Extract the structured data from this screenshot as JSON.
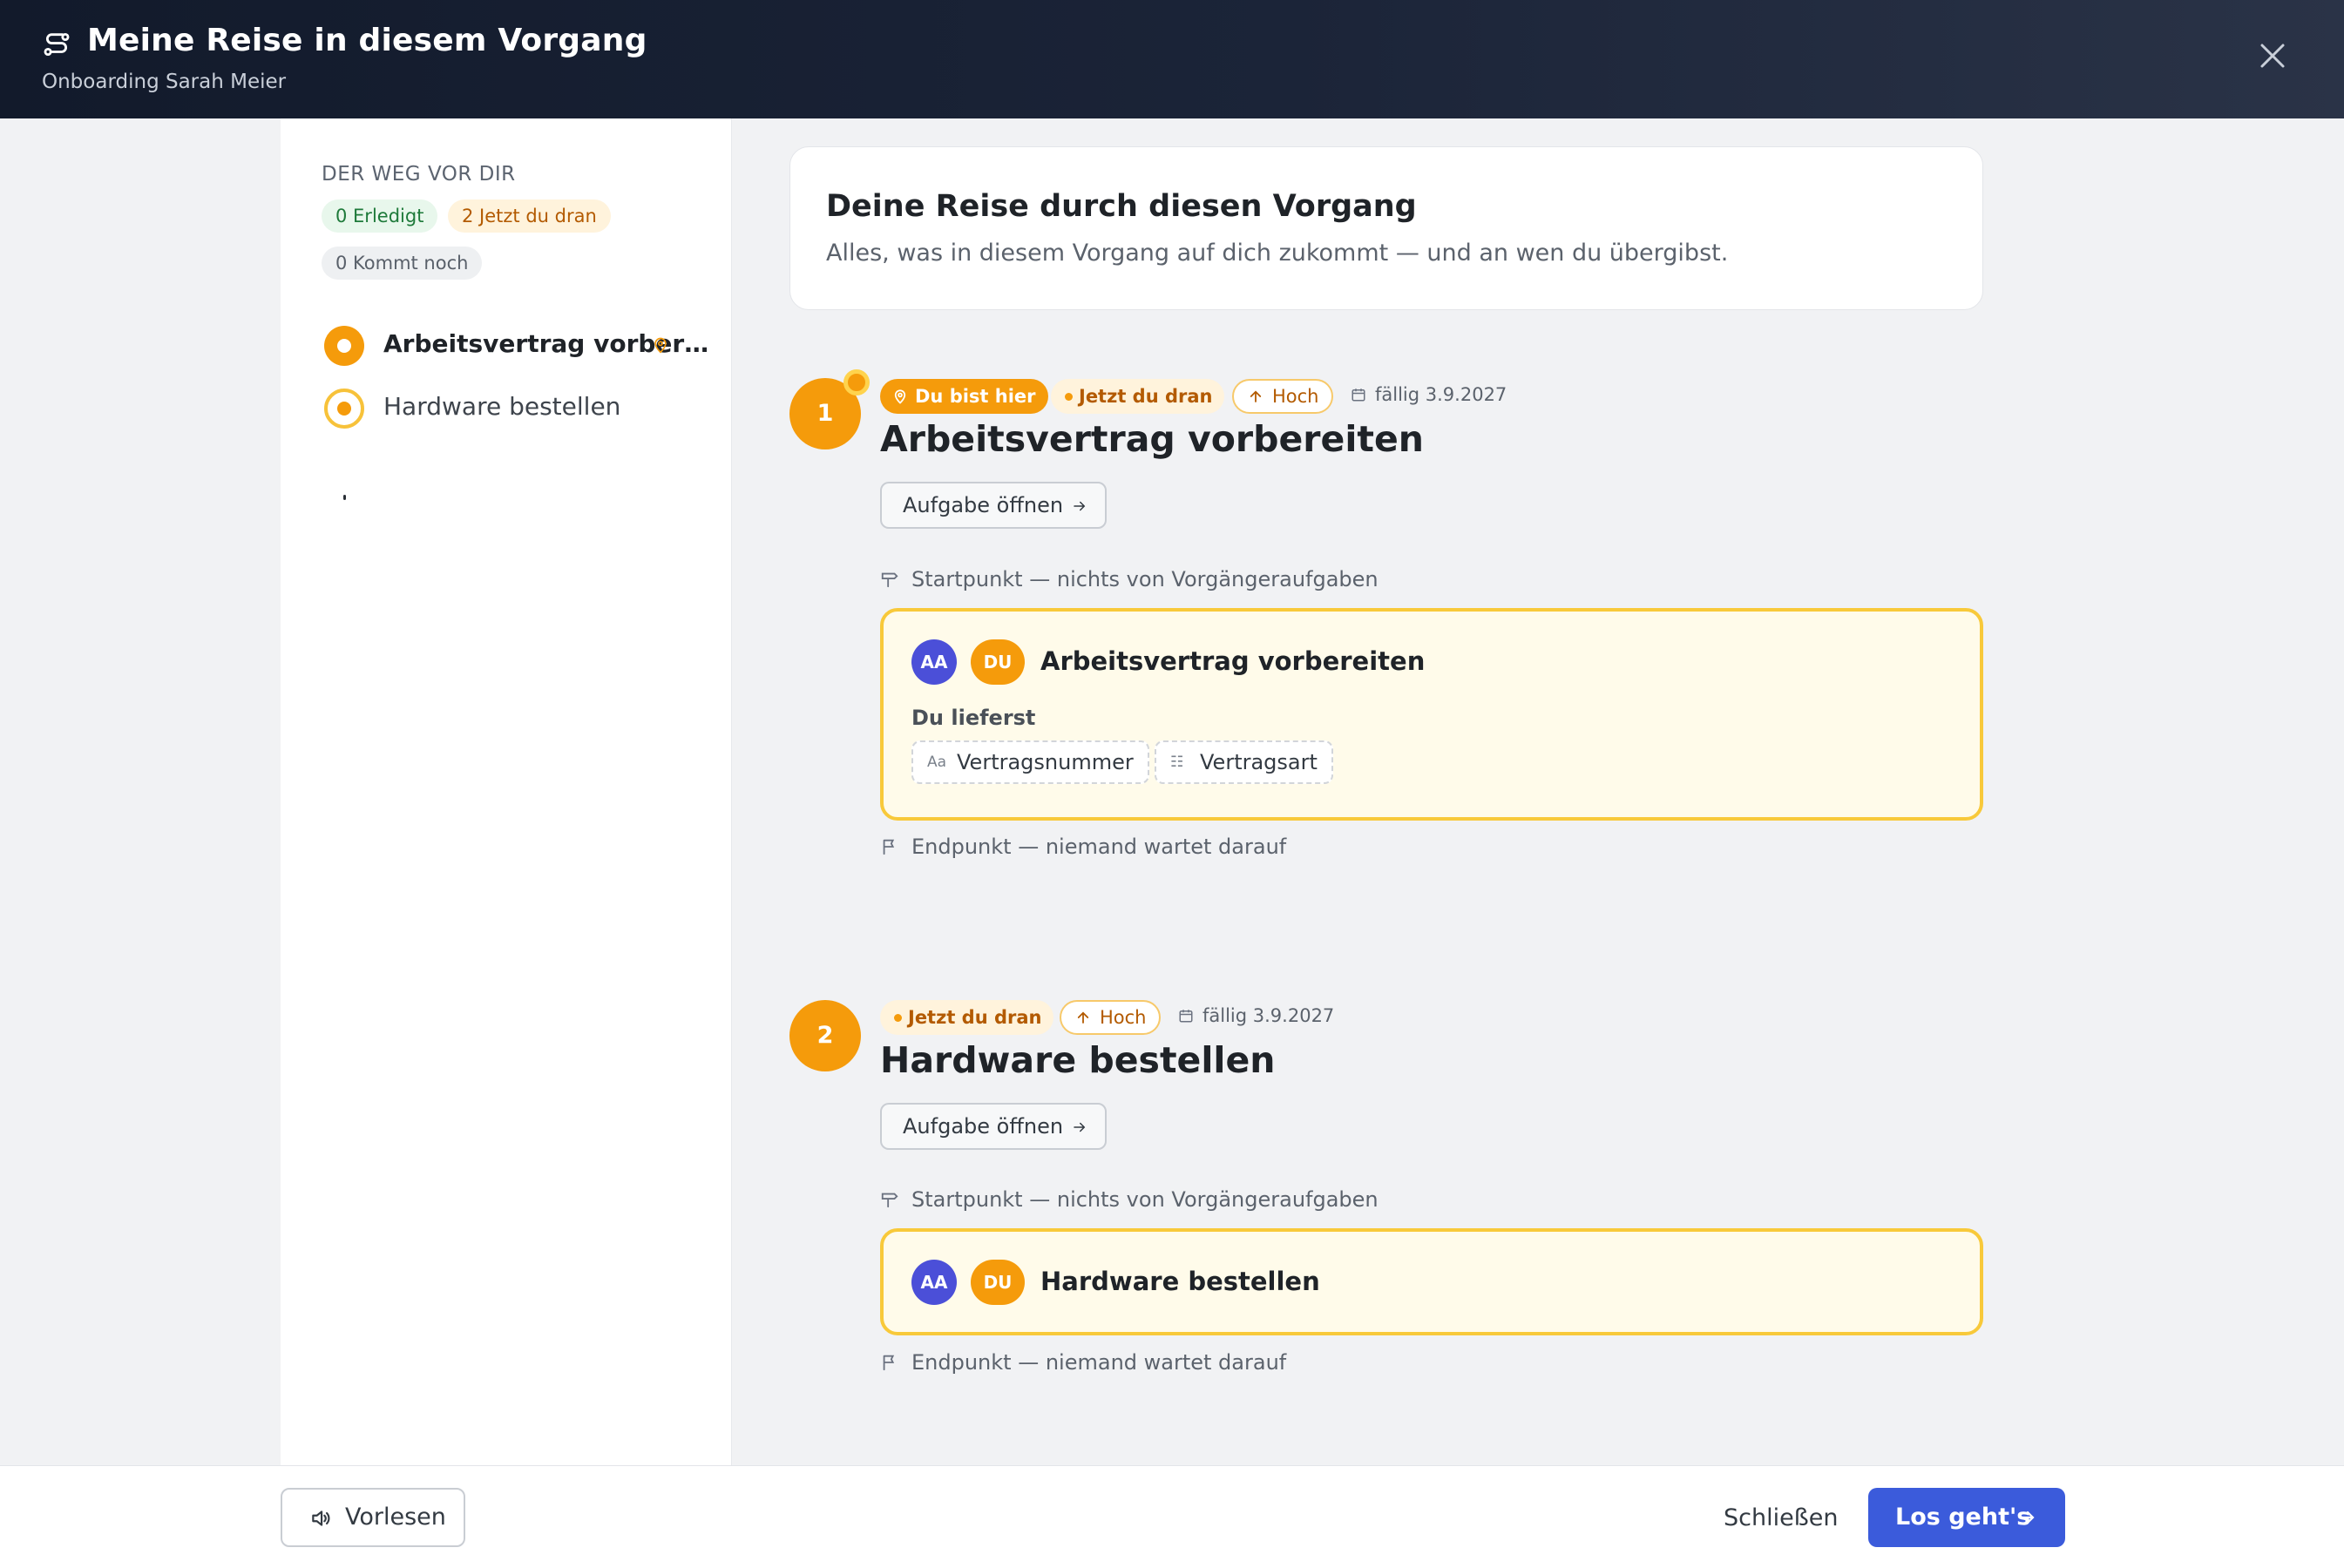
{
  "header": {
    "title": "Meine Reise in diesem Vorgang",
    "subtitle": "Onboarding Sarah Meier",
    "icon": "route-icon",
    "close_icon": "close-icon"
  },
  "sidebar": {
    "section_title": "DER WEG VOR DIR",
    "stats": {
      "done": "0 Erledigt",
      "now": "2 Jetzt du dran",
      "later": "0 Kommt noch"
    },
    "items": [
      {
        "label": "Arbeitsvertrag vorber…",
        "state": "current",
        "pin_icon": "map-pin-icon"
      },
      {
        "label": "Hardware bestellen",
        "state": "upcoming"
      }
    ]
  },
  "intro": {
    "heading": "Deine Reise durch diesen Vorgang",
    "text": "Alles, was in diesem Vorgang auf dich zukommt — und an wen du übergibst."
  },
  "steps": [
    {
      "number": "1",
      "here_badge": "Du bist hier",
      "status_badge": "Jetzt du dran",
      "priority": "Hoch",
      "due": "fällig 3.9.2027",
      "title": "Arbeitsvertrag vorbereiten",
      "open_button": "Aufgabe öffnen",
      "start_note": "Startpunkt — nichts von Vorgängeraufgaben",
      "card": {
        "avatar_1": "AA",
        "avatar_2": "DU",
        "name": "Arbeitsvertrag vorbereiten",
        "deliver_label": "Du lieferst",
        "fields": [
          {
            "icon": "Aa",
            "label": "Vertragsnummer"
          },
          {
            "icon": "☷",
            "label": "Vertragsart"
          }
        ]
      },
      "end_note": "Endpunkt — niemand wartet darauf"
    },
    {
      "number": "2",
      "status_badge": "Jetzt du dran",
      "priority": "Hoch",
      "due": "fällig 3.9.2027",
      "title": "Hardware bestellen",
      "open_button": "Aufgabe öffnen",
      "start_note": "Startpunkt — nichts von Vorgängeraufgaben",
      "card": {
        "avatar_1": "AA",
        "avatar_2": "DU",
        "name": "Hardware bestellen"
      },
      "end_note": "Endpunkt — niemand wartet darauf"
    }
  ],
  "footer": {
    "read_aloud": "Vorlesen",
    "close": "Schließen",
    "go": "Los geht's"
  },
  "colors": {
    "accent_orange": "#f59b0b",
    "card_border": "#f8c93a",
    "primary_blue": "#3b5bdb",
    "avatar_purple": "#4b4fd8"
  }
}
